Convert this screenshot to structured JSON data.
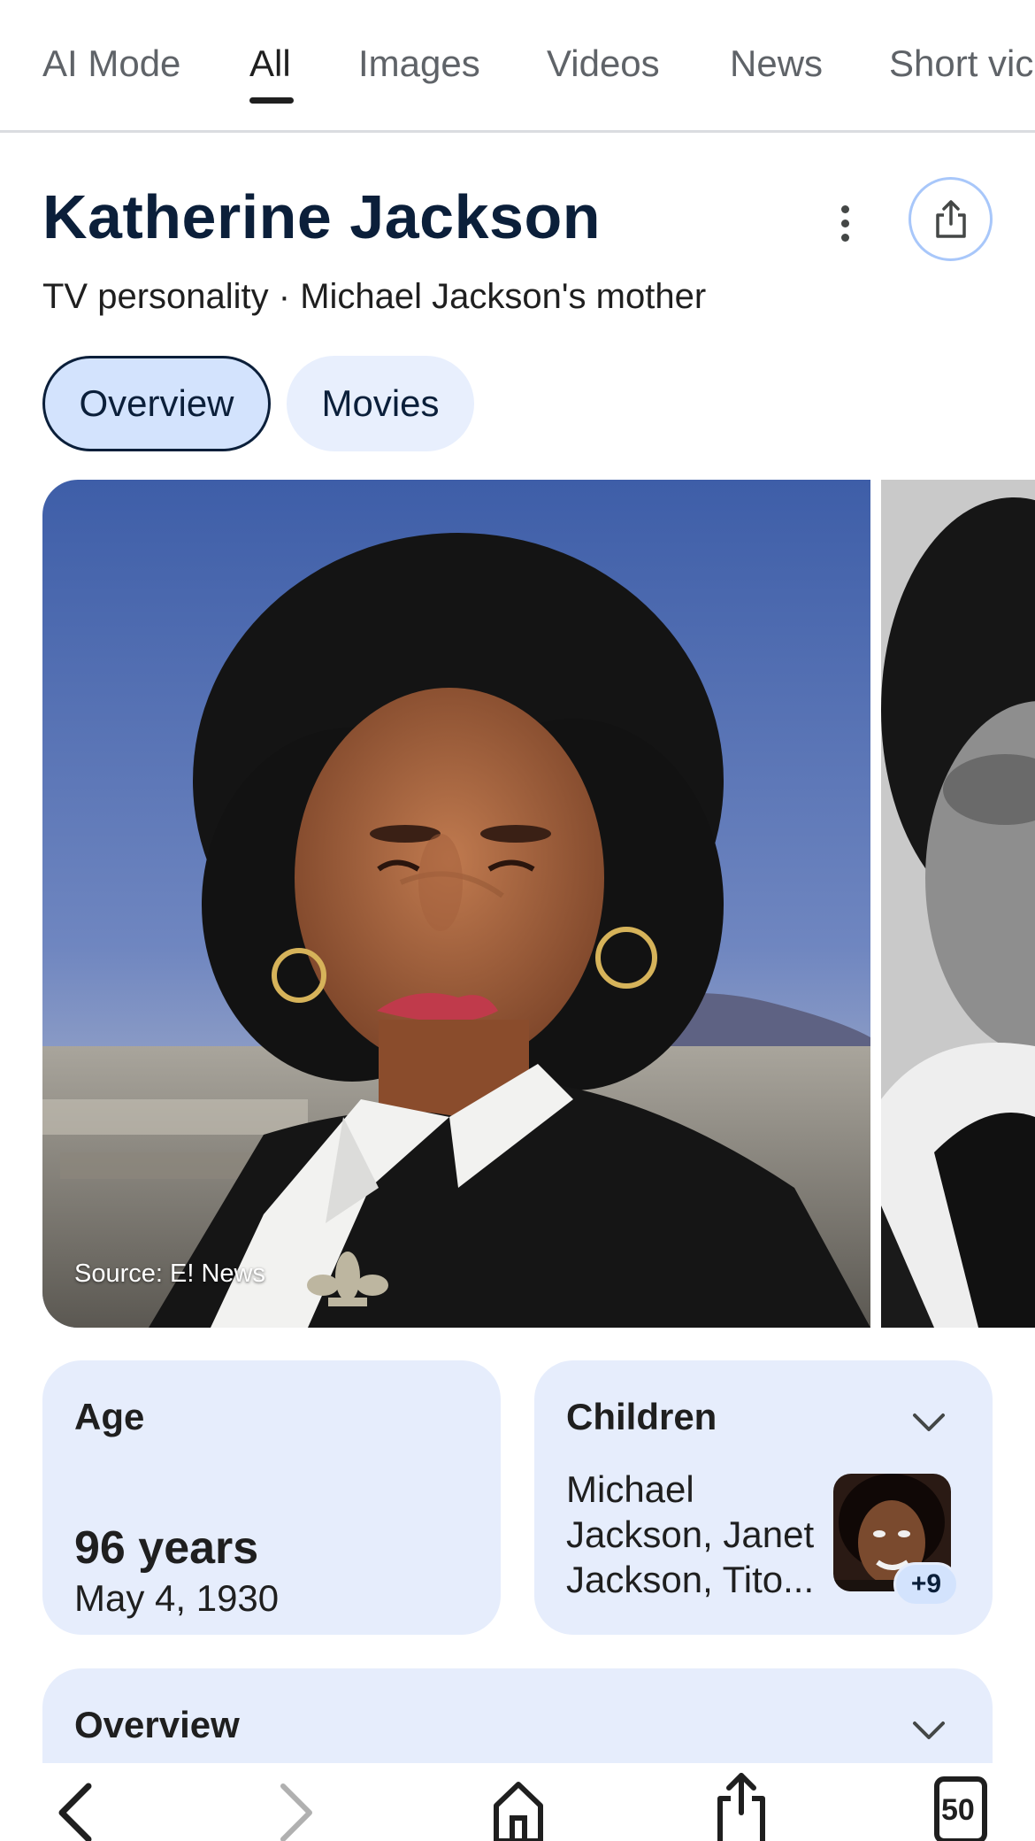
{
  "tabs": [
    {
      "label": "AI Mode",
      "active": false
    },
    {
      "label": "All",
      "active": true
    },
    {
      "label": "Images",
      "active": false
    },
    {
      "label": "Videos",
      "active": false
    },
    {
      "label": "News",
      "active": false
    },
    {
      "label": "Short vic",
      "active": false
    }
  ],
  "header": {
    "title": "Katherine Jackson",
    "subtitle": "TV personality · Michael Jackson's mother"
  },
  "chips": {
    "overview": "Overview",
    "movies": "Movies"
  },
  "hero": {
    "source": "Source: E! News"
  },
  "age_card": {
    "label": "Age",
    "years": "96 years",
    "date": "May 4, 1930"
  },
  "children_card": {
    "label": "Children",
    "text": "Michael Jackson, Janet Jackson, Tito...",
    "extra_count": "+9"
  },
  "overview_card": {
    "label": "Overview"
  },
  "bottom_nav": {
    "tab_count": "50"
  },
  "colors": {
    "accent_chip": "#d3e3fd",
    "card_bg": "#e6edfc",
    "title": "#0b1f3a"
  },
  "icons": [
    "more-vert-icon",
    "share-icon",
    "chevron-down-icon",
    "back-arrow-icon",
    "forward-arrow-icon",
    "home-icon",
    "share-icon",
    "tabs-icon"
  ]
}
